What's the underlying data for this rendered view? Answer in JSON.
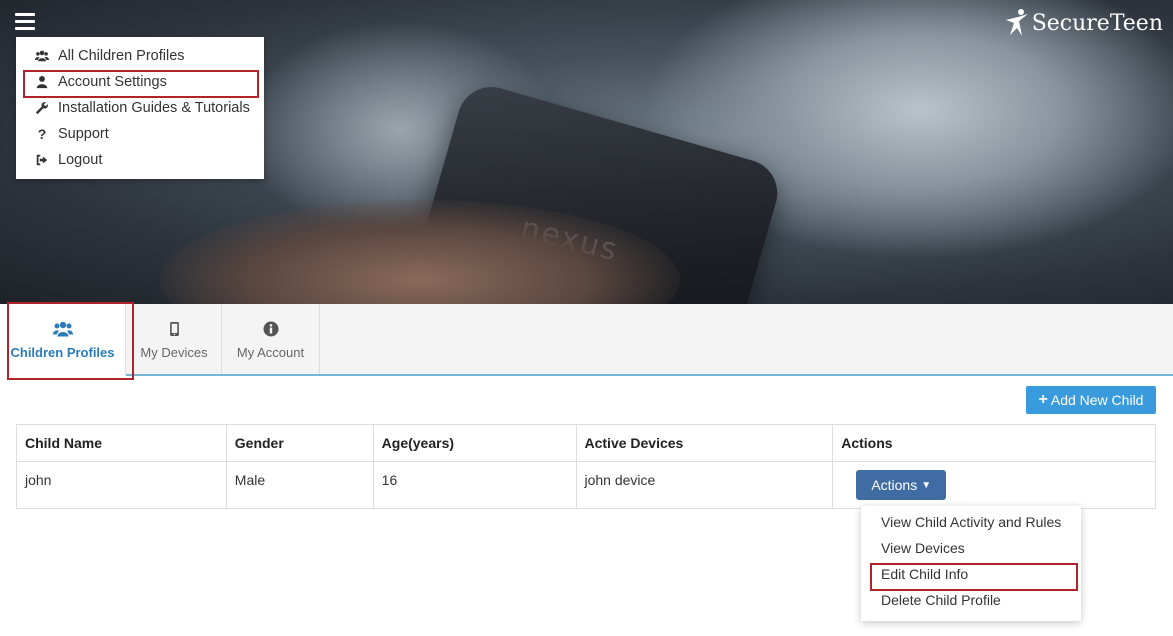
{
  "brand": {
    "logo_text": "SecureTeen"
  },
  "hero": {
    "phone_text": "nexus"
  },
  "menu": {
    "items": [
      {
        "label": "All Children Profiles",
        "icon": "users-icon"
      },
      {
        "label": "Account Settings",
        "icon": "user-icon"
      },
      {
        "label": "Installation Guides & Tutorials",
        "icon": "wrench-icon"
      },
      {
        "label": "Support",
        "icon": "question-icon"
      },
      {
        "label": "Logout",
        "icon": "logout-icon"
      }
    ]
  },
  "tabs": [
    {
      "label": "Children Profiles",
      "icon": "users-icon",
      "active": true
    },
    {
      "label": "My Devices",
      "icon": "mobile-icon",
      "active": false
    },
    {
      "label": "My Account",
      "icon": "info-icon",
      "active": false
    }
  ],
  "add_button": {
    "label": "Add New Child"
  },
  "table": {
    "headers": [
      "Child Name",
      "Gender",
      "Age(years)",
      "Active Devices",
      "Actions"
    ],
    "rows": [
      {
        "name": "john",
        "gender": "Male",
        "age": "16",
        "devices": "john device",
        "action_label": "Actions"
      }
    ]
  },
  "actions_menu": {
    "items": [
      "View Child Activity and Rules",
      "View Devices",
      "Edit Child Info",
      "Delete Child Profile"
    ]
  },
  "colors": {
    "accent": "#2b7bb9",
    "add_button": "#3a9bdc",
    "actions_button": "#3f6ca3",
    "highlight": "#b0232a"
  }
}
